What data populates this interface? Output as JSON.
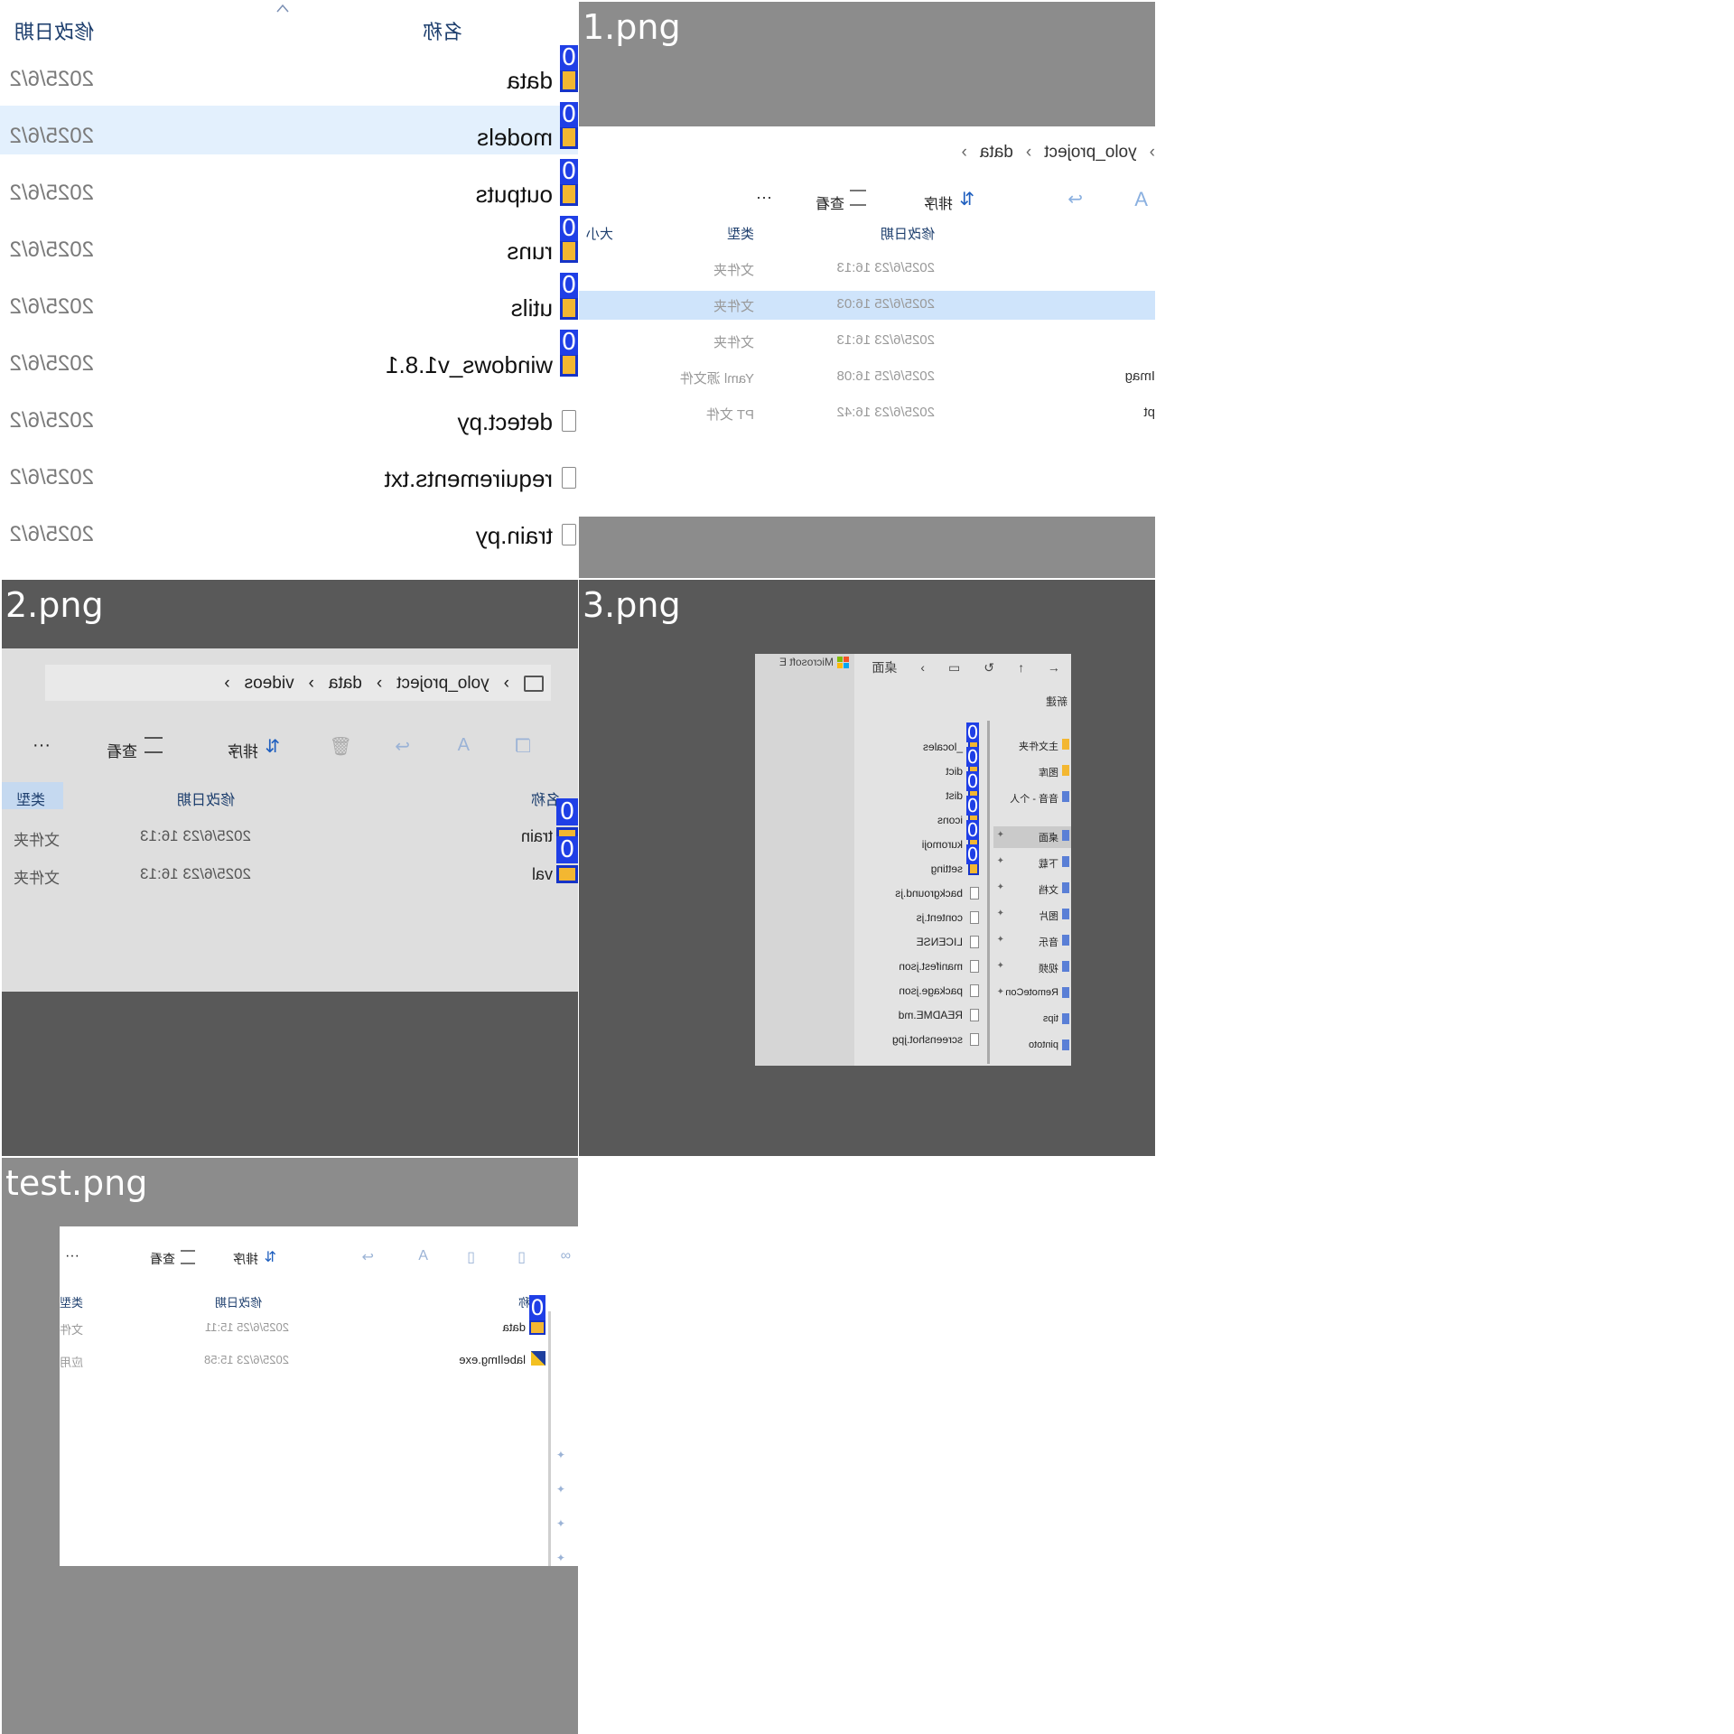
{
  "tile0": {
    "header": {
      "date_col": "修改日期",
      "name_col": "名称"
    },
    "rows": [
      {
        "name": "data",
        "date": "2025/6/2",
        "type": "folder",
        "marker": "0"
      },
      {
        "name": "models",
        "date": "2025/6/2",
        "type": "folder",
        "marker": "0",
        "selected": true
      },
      {
        "name": "outputs",
        "date": "2025/6/2",
        "type": "folder",
        "marker": "0"
      },
      {
        "name": "runs",
        "date": "2025/6/2",
        "type": "folder",
        "marker": "0"
      },
      {
        "name": "utils",
        "date": "2025/6/2",
        "type": "folder",
        "marker": "0"
      },
      {
        "name": "windows_v1.8.1",
        "date": "2025/6/2",
        "type": "folder",
        "marker": "0"
      },
      {
        "name": "detect.py",
        "date": "2025/6/2",
        "type": "file"
      },
      {
        "name": "requirements.txt",
        "date": "2025/6/2",
        "type": "file"
      },
      {
        "name": "train.py",
        "date": "2025/6/2",
        "type": "file"
      }
    ]
  },
  "tile1": {
    "label": "1.png",
    "breadcrumb": [
      "yolo_project",
      "data"
    ],
    "toolbar": {
      "sort": "排序",
      "view": "查看",
      "more": "···"
    },
    "header": {
      "date": "修改日期",
      "type": "类型",
      "size": "大小"
    },
    "rows": [
      {
        "date": "2025/6/23 16:13",
        "type": "文件夹",
        "name": ""
      },
      {
        "date": "2025/6/25 16:03",
        "type": "文件夹",
        "name": "",
        "selected": true
      },
      {
        "date": "2025/6/23 16:13",
        "type": "文件夹",
        "name": ""
      },
      {
        "date": "2025/6/25 16:08",
        "type": "Yaml 源文件",
        "name": "Imag"
      },
      {
        "date": "2025/6/23 16:42",
        "type": "PT 文件",
        "name": "pt"
      }
    ]
  },
  "tile2": {
    "label": "2.png",
    "breadcrumb": [
      "yolo_project",
      "data",
      "videos"
    ],
    "toolbar": {
      "sort": "排序",
      "view": "查看",
      "more": "···"
    },
    "header": {
      "name": "名称",
      "date": "修改日期",
      "type": "类型"
    },
    "rows": [
      {
        "name": "train",
        "date": "2025/6/23 16:13",
        "type": "文件夹",
        "marker": "0"
      },
      {
        "name": "val",
        "date": "2025/6/23 16:13",
        "type": "文件夹",
        "marker": "0"
      }
    ]
  },
  "tile3": {
    "label": "3.png",
    "titlebar": {
      "location": "桌面",
      "brand": "Microsoft E"
    },
    "new_btn": "新建",
    "files": [
      "_locales",
      "dict",
      "dist",
      "icons",
      "kuromoji",
      "setting",
      "background.js",
      "content.js",
      "LICENSE",
      "manifest.json",
      "package.json",
      "README.md",
      "screenshot.jpg"
    ],
    "markers": [
      "0",
      "0",
      "0",
      "0",
      "0",
      "0"
    ],
    "nav": [
      "主文件夹",
      "图库",
      "音音 - 个人",
      "桌面",
      "下载",
      "文档",
      "图片",
      "音乐",
      "视频",
      "RemoteCon",
      "tips",
      "pintoto"
    ]
  },
  "tile4": {
    "label": "test.png",
    "toolbar": {
      "sort": "排序",
      "view": "查看",
      "more": "···"
    },
    "header": {
      "name": "名称",
      "date": "修改日期",
      "type": "类型"
    },
    "rows": [
      {
        "name": "data",
        "date": "2025/6/25 15:11",
        "type": "文件",
        "marker": "0"
      },
      {
        "name": "labelImg.exe",
        "date": "2025/6/23 15:58",
        "type": "应用"
      }
    ]
  }
}
